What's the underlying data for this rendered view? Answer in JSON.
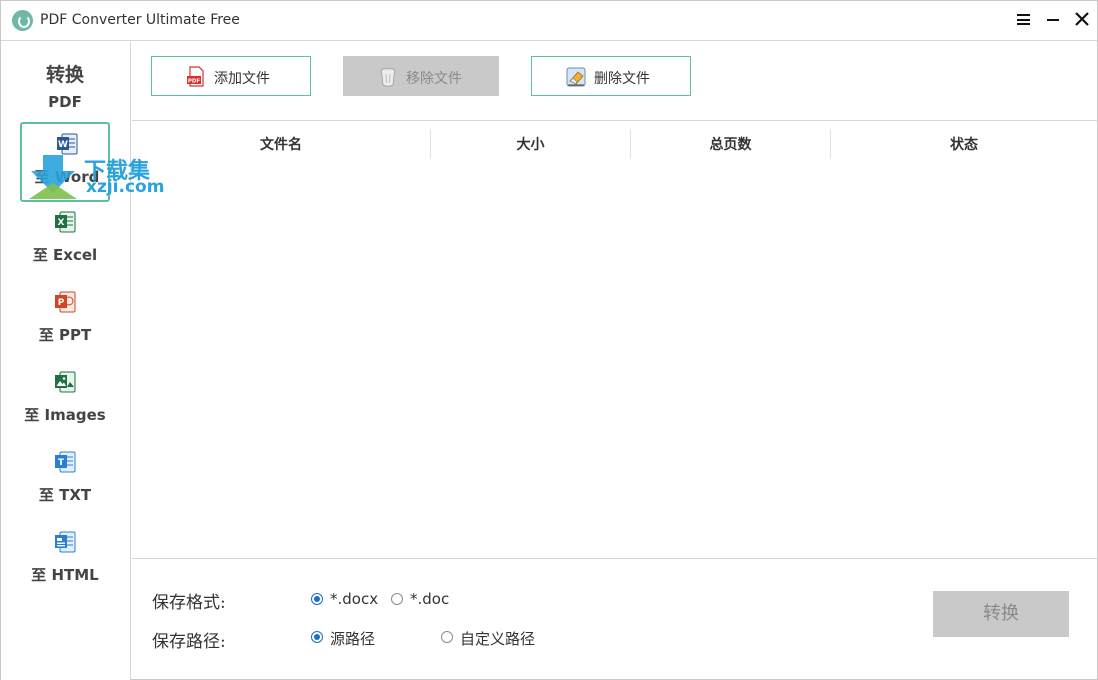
{
  "window": {
    "title": "PDF Converter Ultimate Free"
  },
  "colors": {
    "accent": "#5fbfa6",
    "radio": "#1a6ec7",
    "disabled": "#c9c9c9",
    "word": "#2b5797",
    "excel": "#1e7145",
    "ppt": "#d04525",
    "images": "#1e7145",
    "txt": "#2a7fd4",
    "html": "#2a7fd4",
    "pdf": "#d9302c"
  },
  "sidebar": {
    "heading1": "转换",
    "heading2": "PDF",
    "items": [
      {
        "label": "至 Word",
        "icon": "word-icon",
        "letter": "W",
        "active": true
      },
      {
        "label": "至 Excel",
        "icon": "excel-icon",
        "letter": "X",
        "active": false
      },
      {
        "label": "至 PPT",
        "icon": "ppt-icon",
        "letter": "P",
        "active": false
      },
      {
        "label": "至 Images",
        "icon": "image-icon",
        "letter": "",
        "active": false
      },
      {
        "label": "至 TXT",
        "icon": "txt-icon",
        "letter": "T",
        "active": false
      },
      {
        "label": "至 HTML",
        "icon": "html-icon",
        "letter": "",
        "active": false
      }
    ]
  },
  "toolbar": {
    "add_label": "添加文件",
    "add_icon_text": "PDF",
    "remove_label": "移除文件",
    "delete_label": "删除文件"
  },
  "table": {
    "columns": [
      "文件名",
      "大小",
      "总页数",
      "状态"
    ],
    "rows": []
  },
  "options": {
    "format_label": "保存格式:",
    "format_choices": [
      {
        "label": "*.docx",
        "checked": true
      },
      {
        "label": "*.doc",
        "checked": false
      }
    ],
    "path_label": "保存路径:",
    "path_choices": [
      {
        "label": "源路径",
        "checked": true
      },
      {
        "label": "自定义路径",
        "checked": false
      }
    ]
  },
  "convert_button": {
    "label": "转换"
  },
  "watermark": {
    "line1": "下载集",
    "line2": "xzji.com"
  }
}
